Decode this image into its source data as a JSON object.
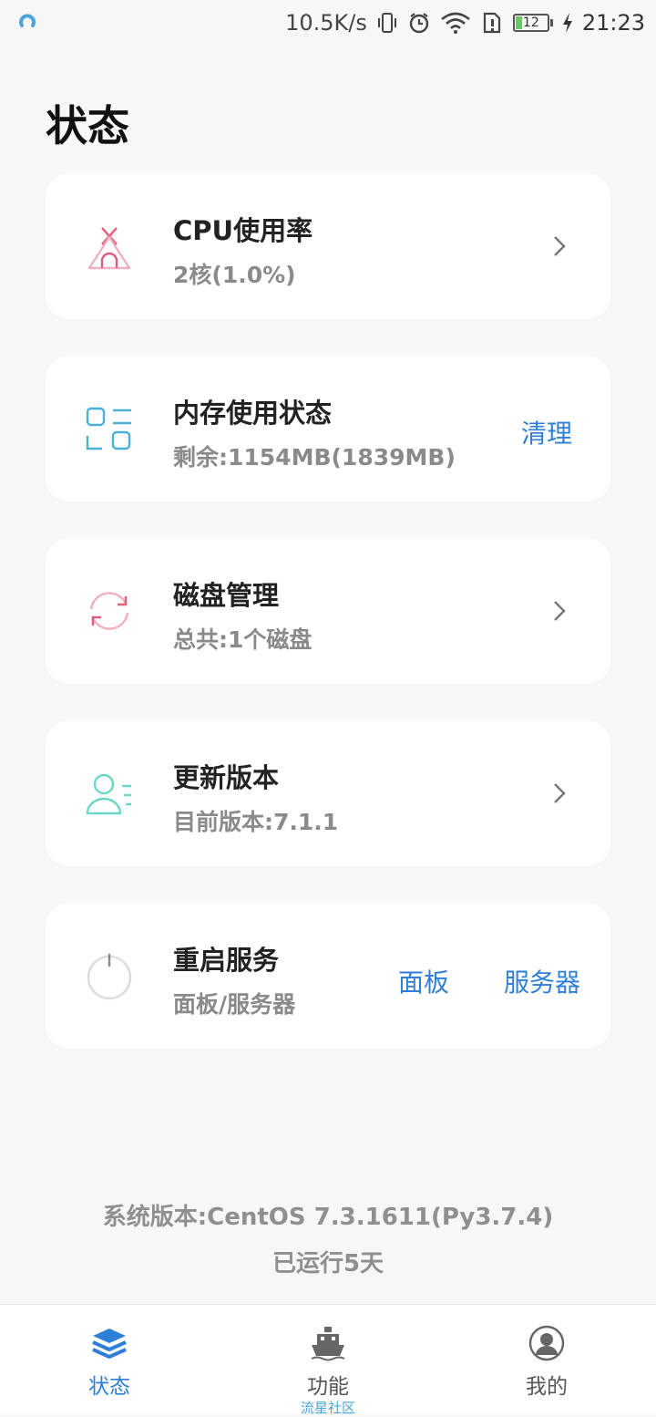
{
  "status_bar": {
    "net_speed": "10.5K/s",
    "battery": "12",
    "time": "21:23"
  },
  "page": {
    "title": "状态"
  },
  "cards": [
    {
      "title": "CPU使用率",
      "subtitle": "2核(1.0%)"
    },
    {
      "title": "内存使用状态",
      "subtitle": "剩余:1154MB(1839MB)",
      "action": "清理"
    },
    {
      "title": "磁盘管理",
      "subtitle": "总共:1个磁盘"
    },
    {
      "title": "更新版本",
      "subtitle": "目前版本:7.1.1"
    },
    {
      "title": "重启服务",
      "subtitle": "面板/服务器",
      "actions": [
        "面板",
        "服务器"
      ]
    }
  ],
  "footer": {
    "system_version": "系统版本:CentOS  7.3.1611(Py3.7.4)",
    "uptime": "已运行5天"
  },
  "tabbar": {
    "tabs": [
      {
        "label": "状态",
        "active": true
      },
      {
        "label": "功能",
        "sub": "流星社区"
      },
      {
        "label": "我的"
      }
    ]
  },
  "colors": {
    "accent": "#2f7fd8",
    "background": "#f7f7f7"
  }
}
